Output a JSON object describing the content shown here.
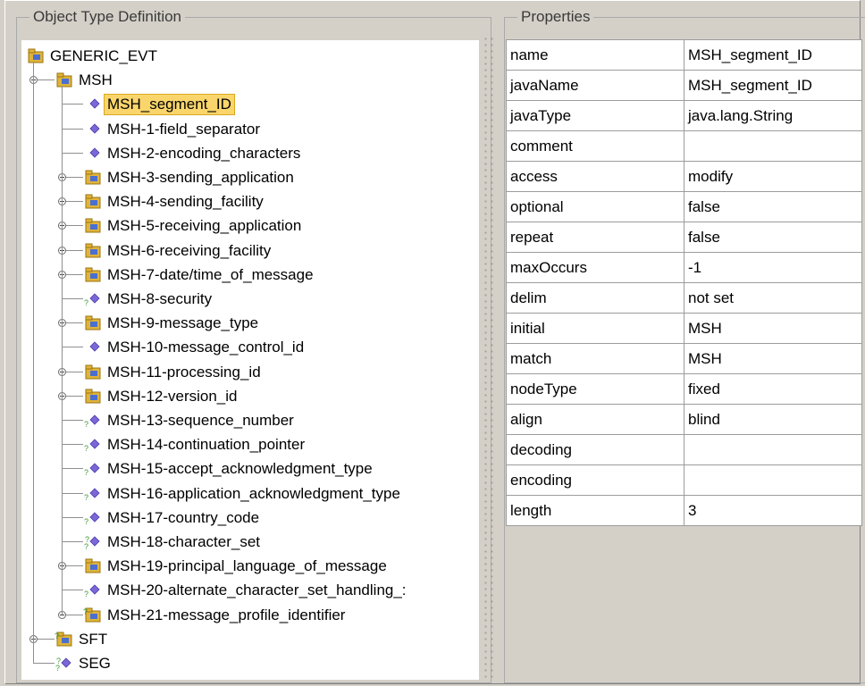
{
  "panels": {
    "left_title": "Object Type Definition",
    "right_title": "Properties"
  },
  "tree": [
    {
      "label": "GENERIC_EVT",
      "depth": 0,
      "icon": "folder-node-icon",
      "expander": false,
      "selected": false
    },
    {
      "label": "MSH",
      "depth": 1,
      "icon": "folder-node-icon",
      "expander": true,
      "selected": false
    },
    {
      "label": "MSH_segment_ID",
      "depth": 2,
      "icon": "diamond-field-icon",
      "expander": false,
      "selected": true
    },
    {
      "label": "MSH-1-field_separator",
      "depth": 2,
      "icon": "diamond-field-icon",
      "expander": false,
      "selected": false
    },
    {
      "label": "MSH-2-encoding_characters",
      "depth": 2,
      "icon": "diamond-field-icon",
      "expander": false,
      "selected": false
    },
    {
      "label": "MSH-3-sending_application",
      "depth": 2,
      "icon": "folder-node-icon",
      "expander": true,
      "selected": false
    },
    {
      "label": "MSH-4-sending_facility",
      "depth": 2,
      "icon": "folder-node-icon",
      "expander": true,
      "selected": false
    },
    {
      "label": "MSH-5-receiving_application",
      "depth": 2,
      "icon": "folder-node-icon",
      "expander": true,
      "selected": false
    },
    {
      "label": "MSH-6-receiving_facility",
      "depth": 2,
      "icon": "folder-node-icon",
      "expander": true,
      "selected": false
    },
    {
      "label": "MSH-7-date/time_of_message",
      "depth": 2,
      "icon": "folder-node-icon",
      "expander": true,
      "selected": false
    },
    {
      "label": "MSH-8-security",
      "depth": 2,
      "icon": "optional-field-icon",
      "expander": false,
      "selected": false
    },
    {
      "label": "MSH-9-message_type",
      "depth": 2,
      "icon": "folder-node-icon",
      "expander": true,
      "selected": false
    },
    {
      "label": "MSH-10-message_control_id",
      "depth": 2,
      "icon": "diamond-field-icon",
      "expander": false,
      "selected": false
    },
    {
      "label": "MSH-11-processing_id",
      "depth": 2,
      "icon": "folder-node-icon",
      "expander": true,
      "selected": false
    },
    {
      "label": "MSH-12-version_id",
      "depth": 2,
      "icon": "folder-node-icon",
      "expander": true,
      "selected": false
    },
    {
      "label": "MSH-13-sequence_number",
      "depth": 2,
      "icon": "optional-field-icon",
      "expander": false,
      "selected": false
    },
    {
      "label": "MSH-14-continuation_pointer",
      "depth": 2,
      "icon": "optional-field-icon",
      "expander": false,
      "selected": false
    },
    {
      "label": "MSH-15-accept_acknowledgment_type",
      "depth": 2,
      "icon": "optional-field-icon",
      "expander": false,
      "selected": false
    },
    {
      "label": "MSH-16-application_acknowledgment_type",
      "depth": 2,
      "icon": "optional-field-icon",
      "expander": false,
      "selected": false
    },
    {
      "label": "MSH-17-country_code",
      "depth": 2,
      "icon": "optional-field-icon",
      "expander": false,
      "selected": false
    },
    {
      "label": "MSH-18-character_set",
      "depth": 2,
      "icon": "repeat-field-icon",
      "expander": false,
      "selected": false
    },
    {
      "label": "MSH-19-principal_language_of_message",
      "depth": 2,
      "icon": "folder-node-icon",
      "expander": true,
      "selected": false
    },
    {
      "label": "MSH-20-alternate_character_set_handling_:",
      "depth": 2,
      "icon": "optional-field-icon",
      "expander": false,
      "selected": false
    },
    {
      "label": "MSH-21-message_profile_identifier",
      "depth": 2,
      "icon": "repeat-folder-icon",
      "expander": true,
      "selected": false
    },
    {
      "label": "SFT",
      "depth": 1,
      "icon": "repeat-folder-icon",
      "expander": true,
      "selected": false
    },
    {
      "label": "SEG",
      "depth": 1,
      "icon": "repeat-field-icon",
      "expander": false,
      "selected": false
    }
  ],
  "properties": [
    {
      "key": "name",
      "value": "MSH_segment_ID"
    },
    {
      "key": "javaName",
      "value": "MSH_segment_ID"
    },
    {
      "key": "javaType",
      "value": "java.lang.String"
    },
    {
      "key": "comment",
      "value": ""
    },
    {
      "key": "access",
      "value": "modify"
    },
    {
      "key": "optional",
      "value": "false"
    },
    {
      "key": "repeat",
      "value": "false"
    },
    {
      "key": "maxOccurs",
      "value": "-1"
    },
    {
      "key": "delim",
      "value": "not set"
    },
    {
      "key": "initial",
      "value": "MSH"
    },
    {
      "key": "match",
      "value": "MSH"
    },
    {
      "key": "nodeType",
      "value": "fixed"
    },
    {
      "key": "align",
      "value": "blind"
    },
    {
      "key": "decoding",
      "value": ""
    },
    {
      "key": "encoding",
      "value": ""
    },
    {
      "key": "length",
      "value": "3"
    }
  ],
  "colors": {
    "selection": "#f9d56b",
    "diamond": "#7b68d8",
    "folder": "#e0b33a",
    "folder_accent": "#4a6fd0",
    "optional_mark": "#3a9a3a"
  }
}
